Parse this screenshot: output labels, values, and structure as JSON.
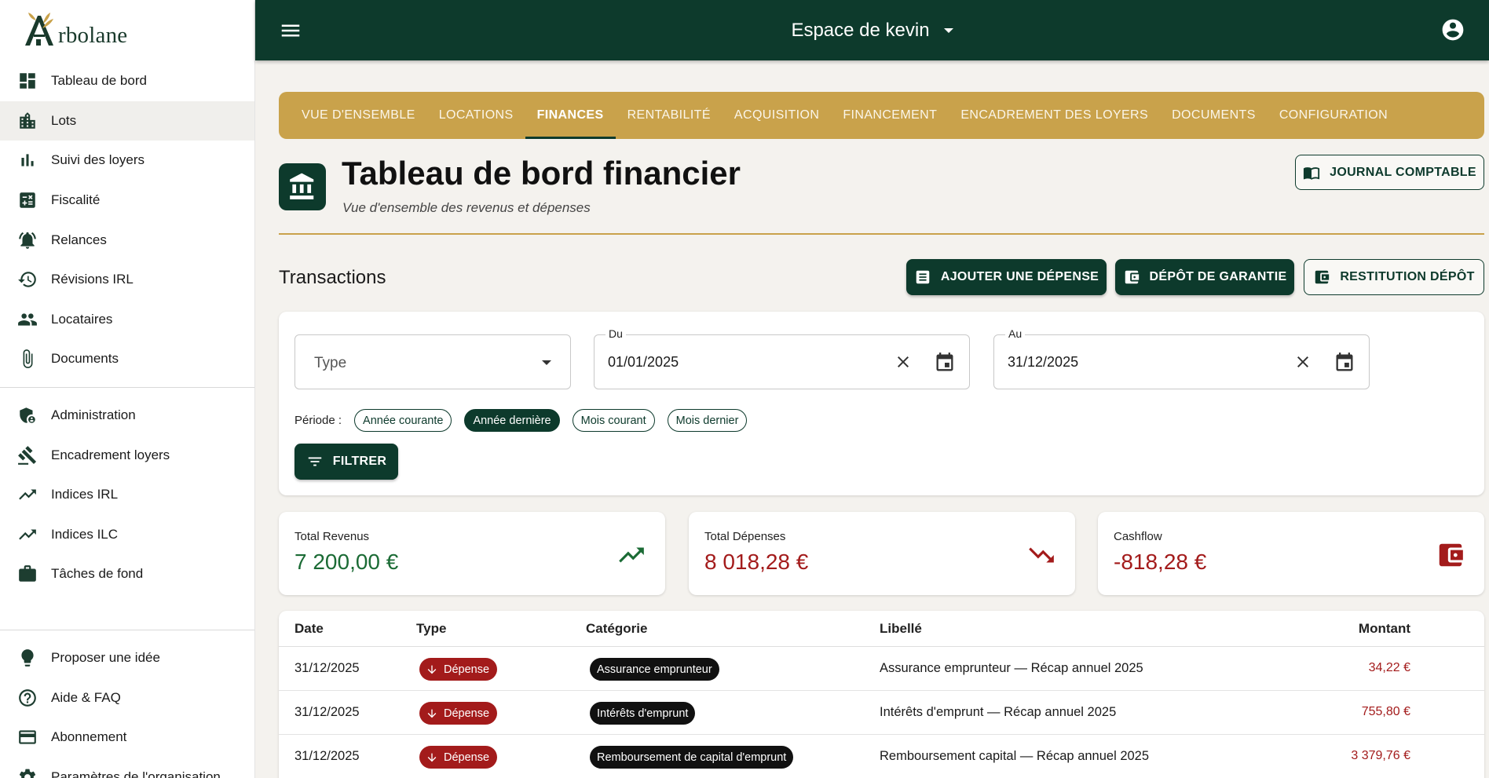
{
  "brand": {
    "logo_text": "rbolane"
  },
  "sidebar": {
    "items": [
      {
        "label": "Tableau de bord",
        "icon": "dashboard-icon"
      },
      {
        "label": "Lots",
        "icon": "building-icon",
        "active": true
      },
      {
        "label": "Suivi des loyers",
        "icon": "bar-chart-icon"
      },
      {
        "label": "Fiscalité",
        "icon": "calculator-icon"
      },
      {
        "label": "Relances",
        "icon": "alarm-bell-icon"
      },
      {
        "label": "Révisions IRL",
        "icon": "history-icon"
      },
      {
        "label": "Locataires",
        "icon": "people-icon"
      },
      {
        "label": "Documents",
        "icon": "paperclip-icon"
      },
      {
        "label": "Administration",
        "icon": "admin-shield-icon"
      },
      {
        "label": "Encadrement loyers",
        "icon": "gavel-icon"
      },
      {
        "label": "Indices IRL",
        "icon": "trending-up-icon"
      },
      {
        "label": "Indices ILC",
        "icon": "trending-up-icon"
      },
      {
        "label": "Tâches de fond",
        "icon": "briefcase-icon"
      },
      {
        "label": "Proposer une idée",
        "icon": "lightbulb-icon"
      },
      {
        "label": "Aide & FAQ",
        "icon": "help-icon"
      },
      {
        "label": "Abonnement",
        "icon": "credit-card-icon"
      },
      {
        "label": "Paramètres de l'organisation",
        "icon": "gear-icon"
      }
    ]
  },
  "topbar": {
    "workspace": "Espace de kevin"
  },
  "tabs": [
    {
      "label": "VUE D'ENSEMBLE"
    },
    {
      "label": "LOCATIONS"
    },
    {
      "label": "FINANCES",
      "active": true
    },
    {
      "label": "RENTABILITÉ"
    },
    {
      "label": "ACQUISITION"
    },
    {
      "label": "FINANCEMENT"
    },
    {
      "label": "ENCADREMENT DES LOYERS"
    },
    {
      "label": "DOCUMENTS"
    },
    {
      "label": "CONFIGURATION"
    }
  ],
  "header": {
    "title": "Tableau de bord financier",
    "subtitle": "Vue d'ensemble des revenus et dépenses",
    "journal_button": "JOURNAL COMPTABLE"
  },
  "transactions": {
    "title": "Transactions",
    "add_expense": "AJOUTER UNE DÉPENSE",
    "deposit": "DÉPÔT DE GARANTIE",
    "deposit_return": "RESTITUTION DÉPÔT"
  },
  "filters": {
    "type_placeholder": "Type",
    "from_label": "Du",
    "from_value": "01/01/2025",
    "to_label": "Au",
    "to_value": "31/12/2025",
    "period_label": "Période :",
    "chips": [
      {
        "label": "Année courante",
        "selected": false
      },
      {
        "label": "Année dernière",
        "selected": true
      },
      {
        "label": "Mois courant",
        "selected": false
      },
      {
        "label": "Mois dernier",
        "selected": false
      }
    ],
    "filter_button": "FILTRER"
  },
  "kpis": [
    {
      "label": "Total Revenus",
      "value": "7 200,00 €",
      "color": "#1b6b35",
      "icon": "trending-up-icon"
    },
    {
      "label": "Total Dépenses",
      "value": "8 018,28 €",
      "color": "#a31b1b",
      "icon": "trending-down-icon"
    },
    {
      "label": "Cashflow",
      "value": "-818,28 €",
      "color": "#a31b1b",
      "icon": "wallet-icon"
    }
  ],
  "table": {
    "headers": [
      "Date",
      "Type",
      "Catégorie",
      "Libellé",
      "Montant"
    ],
    "rows": [
      {
        "date": "31/12/2025",
        "type": "Dépense",
        "category": "Assurance emprunteur",
        "label": "Assurance emprunteur — Récap annuel 2025",
        "amount": "34,22 €"
      },
      {
        "date": "31/12/2025",
        "type": "Dépense",
        "category": "Intérêts d'emprunt",
        "label": "Intérêts d'emprunt — Récap annuel 2025",
        "amount": "755,80 €"
      },
      {
        "date": "31/12/2025",
        "type": "Dépense",
        "category": "Remboursement de capital d'emprunt",
        "label": "Remboursement capital — Récap annuel 2025",
        "amount": "3 379,76 €"
      }
    ]
  },
  "colors": {
    "primary": "#0d3a2c",
    "accent": "#c9a24b",
    "expense": "#a31b1b",
    "income": "#1b6b35"
  }
}
